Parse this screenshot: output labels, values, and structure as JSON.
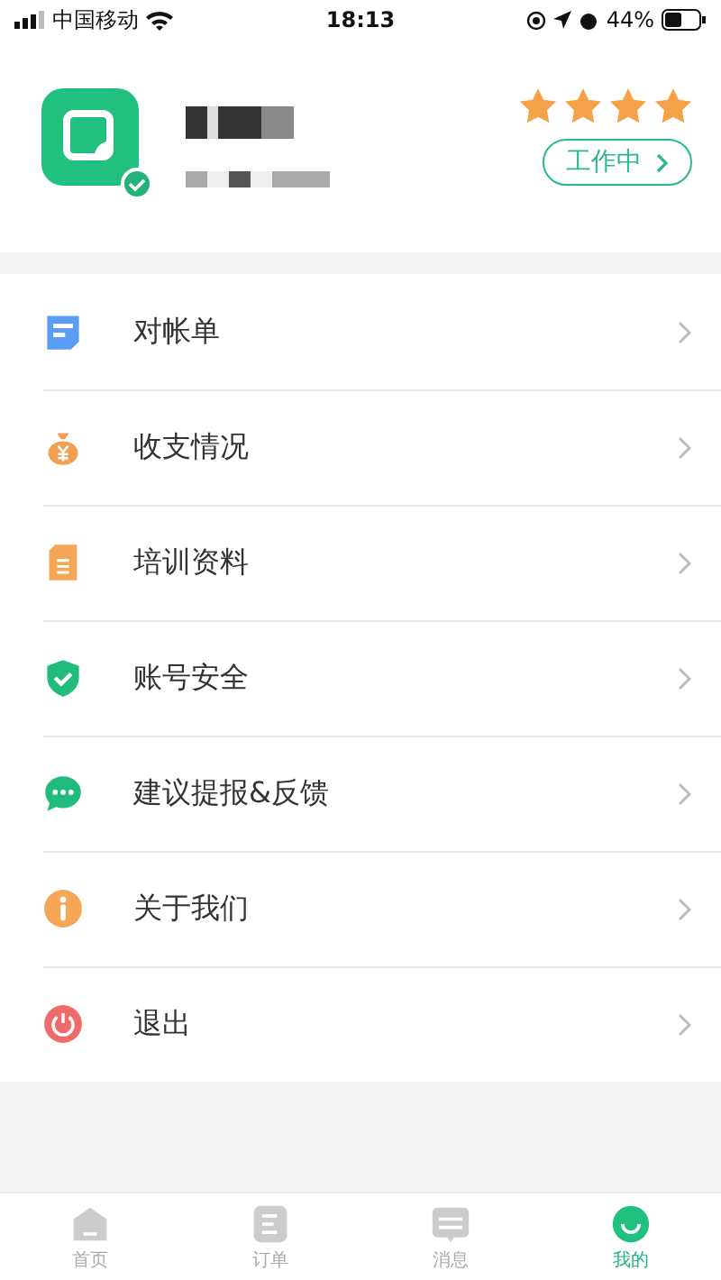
{
  "status_bar": {
    "carrier": "中国移动",
    "time": "18:13",
    "battery": "44%"
  },
  "profile": {
    "stars": 4,
    "status_button": "工作中",
    "verified": true
  },
  "menu": [
    {
      "label": "对帐单"
    },
    {
      "label": "收支情况"
    },
    {
      "label": "培训资料"
    },
    {
      "label": "账号安全"
    },
    {
      "label": "建议提报&反馈"
    },
    {
      "label": "关于我们"
    },
    {
      "label": "退出"
    }
  ],
  "tabs": [
    {
      "label": "首页",
      "selected": false
    },
    {
      "label": "订单",
      "selected": false
    },
    {
      "label": "消息",
      "selected": false
    },
    {
      "label": "我的",
      "selected": true
    }
  ]
}
